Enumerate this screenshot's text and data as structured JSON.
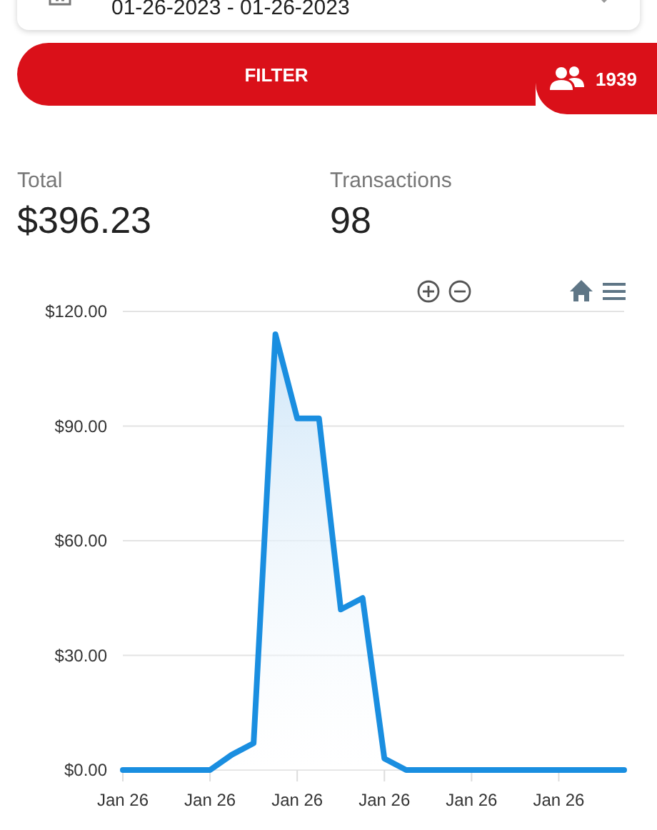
{
  "date_range": {
    "value": "01-26-2023 - 01-26-2023"
  },
  "filter_button": {
    "label": "FILTER"
  },
  "users_badge": {
    "count": "1939"
  },
  "stats": [
    {
      "label": "Total",
      "value": "$396.23"
    },
    {
      "label": "Transactions",
      "value": "98"
    }
  ],
  "chart": {
    "chart_data": {
      "type": "area",
      "categories": [
        "Jan 26",
        null,
        null,
        null,
        "Jan 26",
        null,
        null,
        null,
        "Jan 26",
        null,
        null,
        null,
        "Jan 26",
        null,
        null,
        null,
        "Jan 26",
        null,
        null,
        null,
        "Jan 26",
        null,
        null,
        null
      ],
      "series": [
        {
          "color": "#1a8ee0",
          "values": [
            0,
            0,
            0,
            0,
            0,
            4,
            7,
            114,
            92,
            92,
            42,
            45,
            3,
            0,
            0,
            0,
            0,
            0,
            0,
            0,
            0,
            0,
            0,
            0
          ]
        }
      ],
      "ylim": [
        0,
        120
      ],
      "grid": true,
      "yticks": [
        {
          "value": 0,
          "label": "$0.00"
        },
        {
          "value": 30,
          "label": "$30.00"
        },
        {
          "value": 60,
          "label": "$60.00"
        },
        {
          "value": 90,
          "label": "$90.00"
        },
        {
          "value": 120,
          "label": "$120.00"
        }
      ]
    }
  }
}
